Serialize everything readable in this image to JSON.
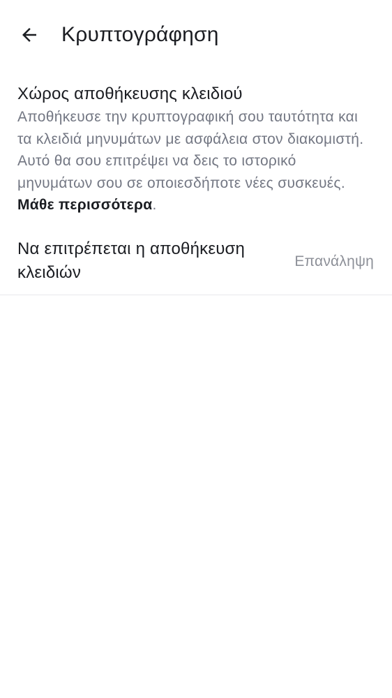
{
  "header": {
    "title": "Κρυπτογράφηση",
    "back_icon": "arrow-left-icon"
  },
  "key_storage": {
    "title": "Χώρος αποθήκευσης κλειδιού",
    "description": "Αποθήκευσε την κρυπτογραφική σου ταυτότητα και τα κλειδιά μηνυμάτων με ασφάλεια στον διακομιστή. Αυτό θα σου επιτρέψει να δεις το ιστορικό μηνυμάτων σου σε οποιεσδήποτε νέες συσκευές.",
    "learn_more": "Μάθε περισσότερα",
    "period": "."
  },
  "allow_storage": {
    "label": "Να επιτρέπεται η αποθήκευση κλειδιών",
    "action": "Επανάληψη"
  },
  "colors": {
    "text_primary": "#1b1d22",
    "text_secondary": "#737783",
    "action_disabled": "#8d9098",
    "divider": "#e8e9ec"
  }
}
